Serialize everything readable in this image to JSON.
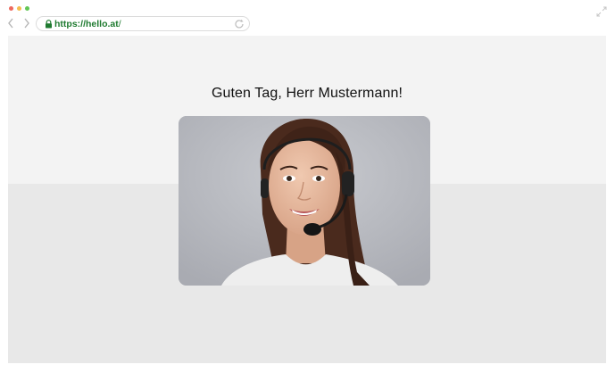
{
  "browser": {
    "url_host": "https://hello.at",
    "url_path": "/",
    "traffic_lights": [
      "#ee6a5f",
      "#f5be4f",
      "#62c655"
    ]
  },
  "page": {
    "greeting": "Guten Tag, Herr Mustermann!"
  },
  "colors": {
    "secure_url": "#1e7a2f",
    "top_band": "#f3f3f3",
    "bottom_band": "#e8e8e8"
  },
  "icons": {
    "back": "chevron-left-icon",
    "forward": "chevron-right-icon",
    "lock": "lock-icon",
    "reload": "reload-icon",
    "fullscreen": "expand-icon"
  }
}
